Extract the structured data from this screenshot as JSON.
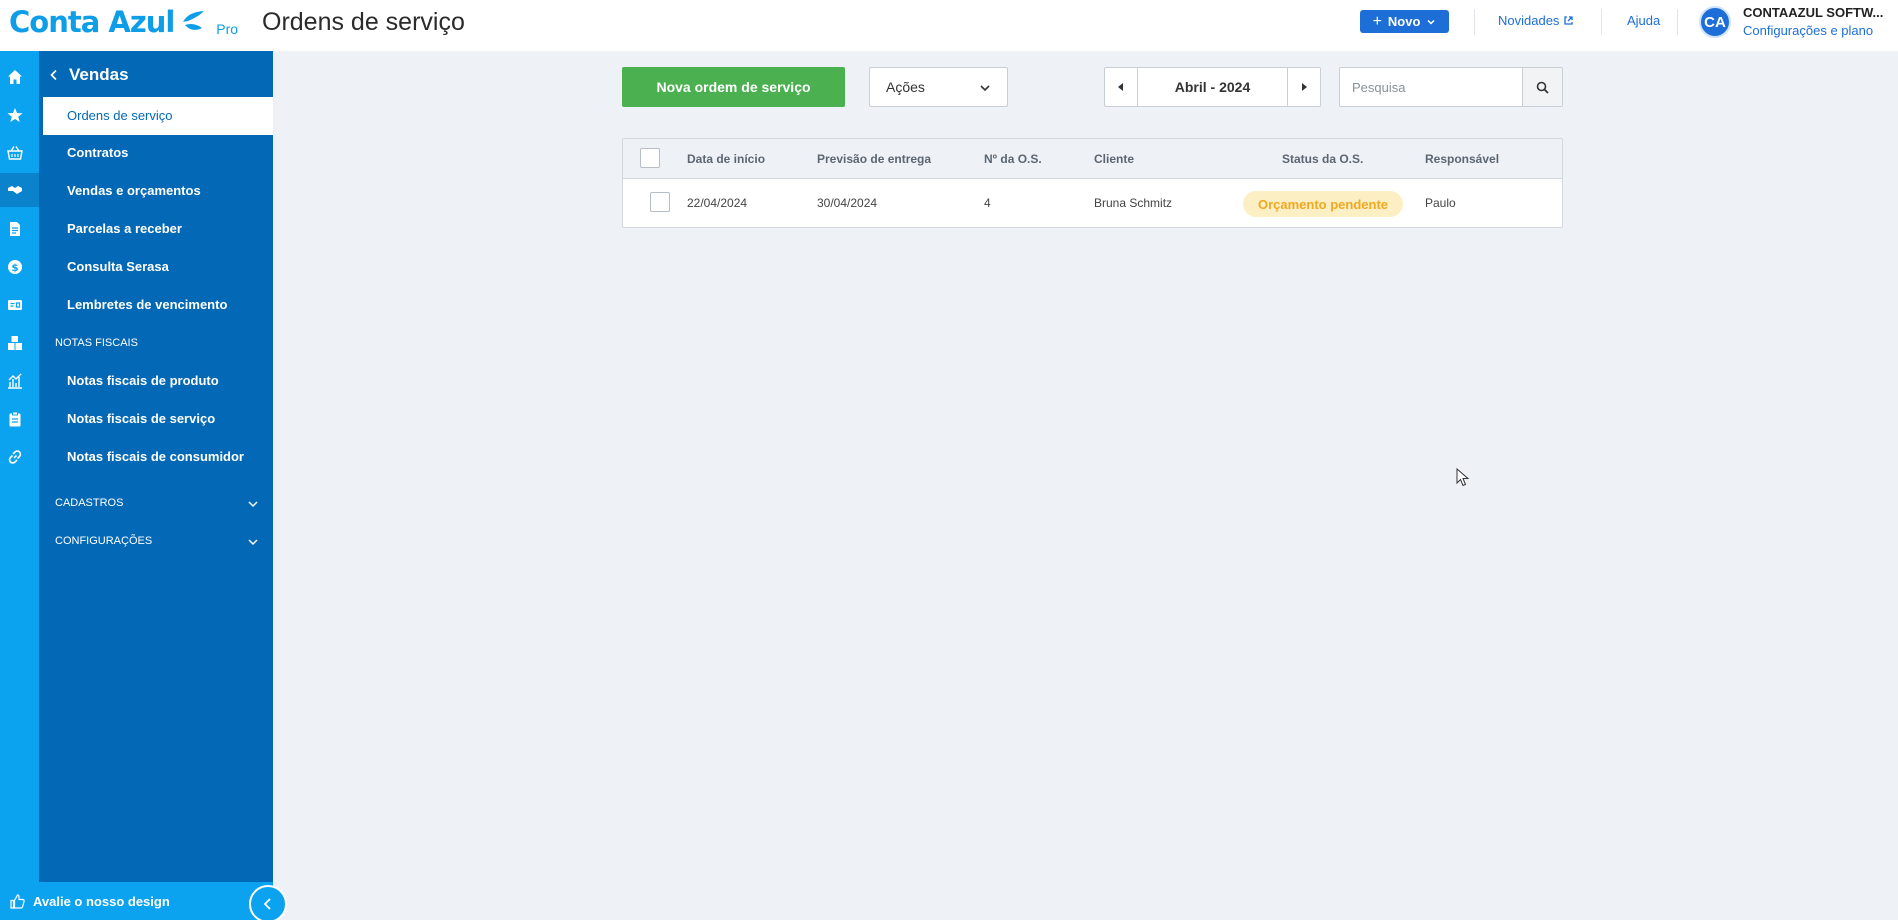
{
  "brand": {
    "name": "Conta Azul",
    "tier": "Pro"
  },
  "page_title": "Ordens de serviço",
  "header": {
    "new_button": "Novo",
    "news_link": "Novidades",
    "help_link": "Ajuda",
    "avatar_initials": "CA",
    "company_name": "CONTAAZUL SOFTW...",
    "company_sub": "Configurações e plano"
  },
  "sidebar": {
    "title": "Vendas",
    "items": [
      {
        "label": "Ordens de serviço",
        "active": true
      },
      {
        "label": "Contratos"
      },
      {
        "label": "Vendas e orçamentos"
      },
      {
        "label": "Parcelas a receber"
      },
      {
        "label": "Consulta Serasa"
      },
      {
        "label": "Lembretes de vencimento"
      }
    ],
    "section_fiscal": "NOTAS FISCAIS",
    "fiscal_items": [
      {
        "label": "Notas fiscais de produto"
      },
      {
        "label": "Notas fiscais de serviço"
      },
      {
        "label": "Notas fiscais de consumidor"
      }
    ],
    "section_cadastros": "CADASTROS",
    "section_config": "CONFIGURAÇÕES",
    "feedback": "Avalie o nosso design"
  },
  "toolbar": {
    "new_order_button": "Nova ordem de serviço",
    "actions_dropdown": "Ações",
    "period": "Abril - 2024",
    "search_placeholder": "Pesquisa"
  },
  "table": {
    "columns": [
      "Data de início",
      "Previsão de entrega",
      "Nº da O.S.",
      "Cliente",
      "Status da O.S.",
      "Responsável"
    ],
    "rows": [
      {
        "start": "22/04/2024",
        "delivery": "30/04/2024",
        "number": "4",
        "client": "Bruna Schmitz",
        "status": "Orçamento pendente",
        "responsible": "Paulo"
      }
    ]
  },
  "colors": {
    "brand_blue": "#0e9ee8",
    "sidebar_blue": "#0368b5",
    "rail_blue": "#0ba3ef",
    "primary_green": "#4bb04f",
    "status_pending_bg": "#fdefc4",
    "status_pending_text": "#f0a820"
  },
  "icons": [
    "home-icon",
    "star-icon",
    "basket-icon",
    "handshake-icon",
    "document-icon",
    "dollar-icon",
    "id-card-icon",
    "boxes-icon",
    "chart-icon",
    "clipboard-icon",
    "link-icon",
    "thumbs-up-icon",
    "search-icon",
    "external-link-icon"
  ]
}
